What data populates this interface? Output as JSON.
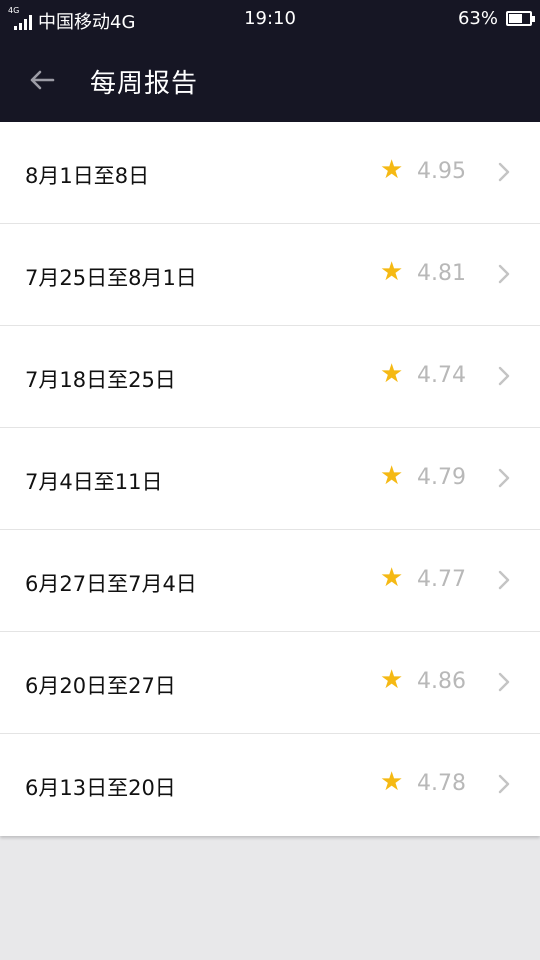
{
  "status_bar": {
    "net_type": "4G",
    "carrier": "中国移动4G",
    "time": "19:10",
    "battery": "63%",
    "battery_level": 0.63
  },
  "app_bar": {
    "back_icon": "arrow-left-icon",
    "title": "每周报告"
  },
  "colors": {
    "header_bg": "#161624",
    "star": "#f5b914",
    "score": "#b8b8b8",
    "page_bg": "#e8e8ea"
  },
  "reports": [
    {
      "label": "8月1日至8日",
      "score": "4.95"
    },
    {
      "label": "7月25日至8月1日",
      "score": "4.81"
    },
    {
      "label": "7月18日至25日",
      "score": "4.74"
    },
    {
      "label": "7月4日至11日",
      "score": "4.79"
    },
    {
      "label": "6月27日至7月4日",
      "score": "4.77"
    },
    {
      "label": "6月20日至27日",
      "score": "4.86"
    },
    {
      "label": "6月13日至20日",
      "score": "4.78"
    }
  ]
}
